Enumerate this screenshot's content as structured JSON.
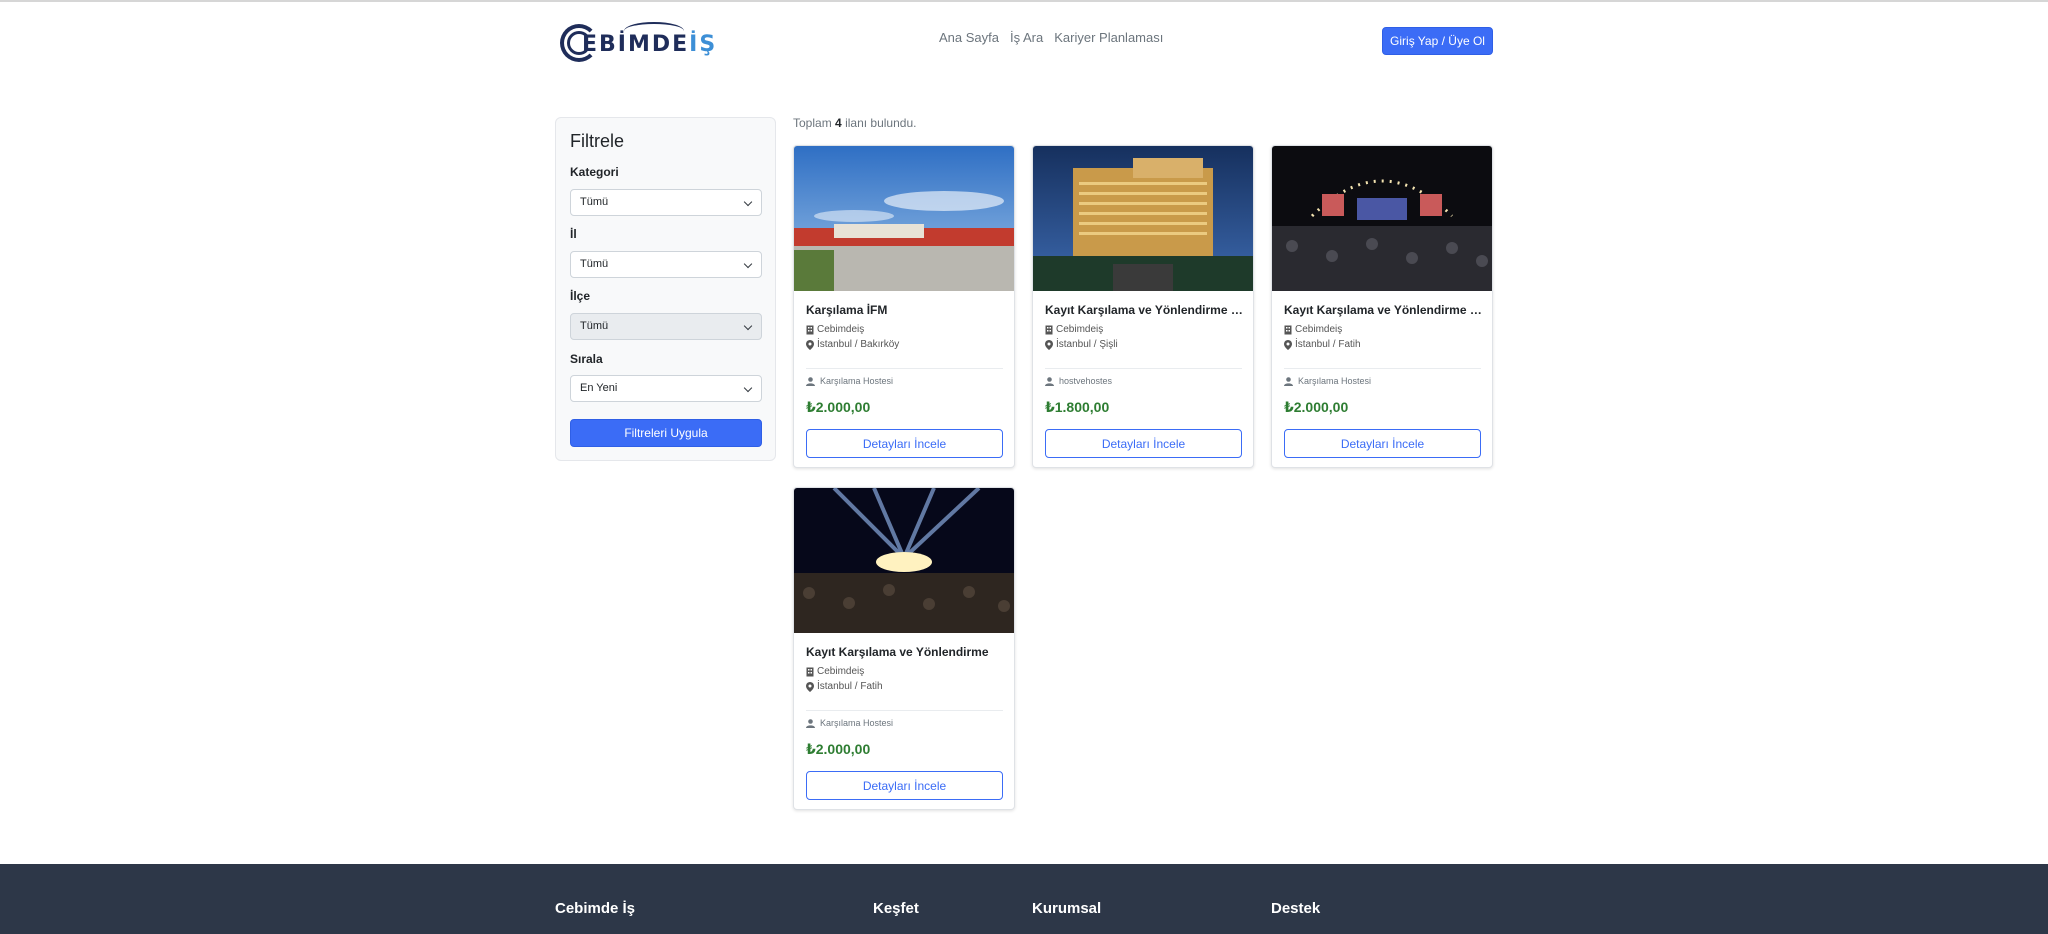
{
  "header": {
    "logo": {
      "main": "EBİMDE",
      "accent": "İŞ",
      "brand_color": "#1f2d5a",
      "accent_color": "#3d8fd6"
    },
    "nav": [
      {
        "label": "Ana Sayfa"
      },
      {
        "label": "İş Ara"
      },
      {
        "label": "Kariyer Planlaması"
      }
    ],
    "login_label": "Giriş Yap / Üye Ol"
  },
  "filters": {
    "title": "Filtrele",
    "fields": [
      {
        "label": "Kategori",
        "value": "Tümü",
        "disabled": false
      },
      {
        "label": "İl",
        "value": "Tümü",
        "disabled": false
      },
      {
        "label": "İlçe",
        "value": "Tümü",
        "disabled": true
      },
      {
        "label": "Sırala",
        "value": "En Yeni",
        "disabled": false
      }
    ],
    "apply_label": "Filtreleri Uygula"
  },
  "results": {
    "prefix": "Toplam",
    "count": "4",
    "suffix": "ilanı bulundu."
  },
  "listings": [
    {
      "title": "Karşılama İFM",
      "company": "Cebimdeiş",
      "location": "İstanbul / Bakırköy",
      "position": "Karşılama Hostesi",
      "price": "₺2.000,00",
      "button": "Detayları İncele"
    },
    {
      "title": "Kayıt Karşılama ve Yönlendirme Hostesi",
      "company": "Cebimdeiş",
      "location": "İstanbul / Şişli",
      "position": "hostvehostes",
      "price": "₺1.800,00",
      "button": "Detayları İncele"
    },
    {
      "title": "Kayıt Karşılama ve Yönlendirme Hostesi",
      "company": "Cebimdeiş",
      "location": "İstanbul / Fatih",
      "position": "Karşılama Hostesi",
      "price": "₺2.000,00",
      "button": "Detayları İncele"
    },
    {
      "title": "Kayıt Karşılama ve Yönlendirme",
      "company": "Cebimdeiş",
      "location": "İstanbul / Fatih",
      "position": "Karşılama Hostesi",
      "price": "₺2.000,00",
      "button": "Detayları İncele"
    }
  ],
  "footer": {
    "columns": [
      {
        "title": "Cebimde İş"
      },
      {
        "title": "Keşfet"
      },
      {
        "title": "Kurumsal"
      },
      {
        "title": "Destek"
      }
    ]
  },
  "colors": {
    "primary": "#3b6cf6",
    "price": "#2e7d32",
    "footer_bg": "#2d3748"
  }
}
